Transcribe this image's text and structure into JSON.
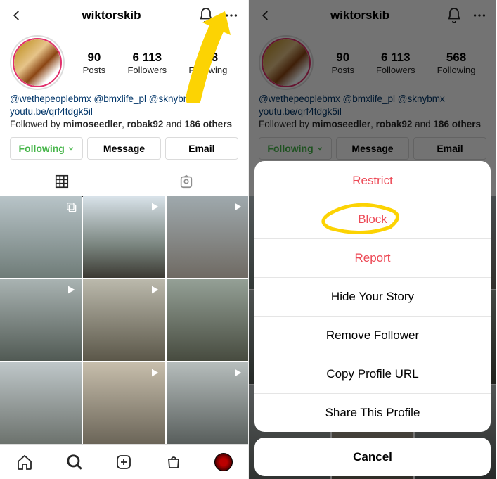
{
  "header": {
    "username": "wiktorskib"
  },
  "stats": {
    "posts": {
      "num": "90",
      "label": "Posts"
    },
    "followers": {
      "num": "6 113",
      "label": "Followers"
    },
    "following": {
      "num": "568",
      "label": "Following"
    }
  },
  "bio": {
    "mentions": "@wethepeoplebmx @bmxlife_pl @sknybmx",
    "link": "youtu.be/qrf4tdgk5il",
    "followed_prefix": "Followed by ",
    "followed_a": "mimoseedler",
    "followed_sep1": ", ",
    "followed_b": "robak92",
    "followed_sep2": " and ",
    "followed_c": "186 others"
  },
  "buttons": {
    "following": "Following",
    "message": "Message",
    "email": "Email"
  },
  "actionsheet": {
    "restrict": "Restrict",
    "block": "Block",
    "report": "Report",
    "hide": "Hide Your Story",
    "remove": "Remove Follower",
    "copy": "Copy Profile URL",
    "share": "Share This Profile",
    "cancel": "Cancel"
  },
  "colors": {
    "danger": "#ed4956",
    "following_green": "#46b549",
    "annotation_yellow": "#fcd303"
  },
  "grid_badges": [
    "multi",
    "play",
    "play",
    "play",
    "play",
    "",
    "",
    "play",
    "play"
  ]
}
